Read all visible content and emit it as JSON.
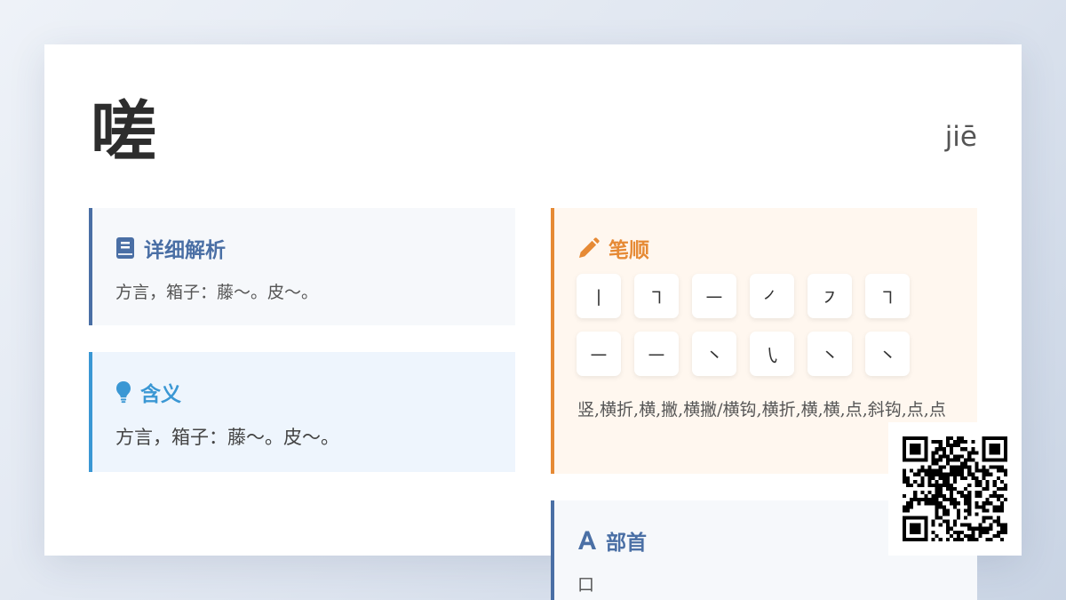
{
  "character": "嗟",
  "pinyin": "jiē",
  "detail": {
    "heading": "详细解析",
    "icon": "book-icon",
    "text": "方言，箱子：藤～。皮～。"
  },
  "meaning": {
    "heading": "含义",
    "icon": "lightbulb-icon",
    "text": "方言，箱子：藤～。皮～。"
  },
  "stroke_order": {
    "heading": "笔顺",
    "icon": "pencil-icon",
    "strokes": [
      "丨",
      "㇕",
      "㇐",
      "㇒",
      "㇇",
      "㇕",
      "㇐",
      "㇐",
      "㇔",
      "㇂",
      "㇔",
      "㇔"
    ],
    "names": "竖,横折,横,撇,横撇/横钩,横折,横,横,点,斜钩,点,点"
  },
  "radical": {
    "heading": "部首",
    "icon": "font-icon",
    "value": "口"
  },
  "colors": {
    "primary": "#4a6fa5",
    "meaning_accent": "#3a97d4",
    "stroke_accent": "#e68a35"
  }
}
